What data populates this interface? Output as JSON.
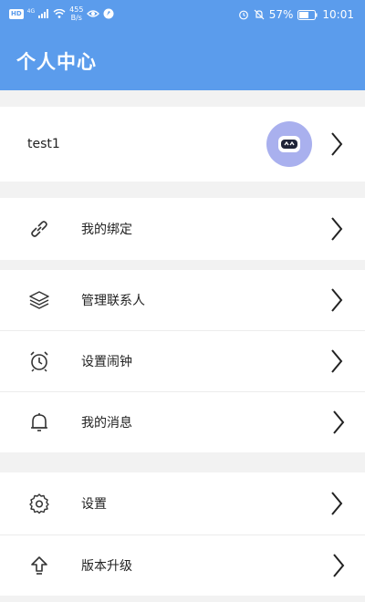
{
  "status_bar": {
    "left_badge": "HD",
    "network": "4G",
    "net_speed_value": "455",
    "net_speed_unit": "B/s",
    "battery": "57%",
    "time": "10:01"
  },
  "header": {
    "title": "个人中心"
  },
  "profile": {
    "username": "test1"
  },
  "menu": {
    "binding": {
      "label": "我的绑定",
      "icon": "link-icon"
    },
    "contacts": {
      "label": "管理联系人",
      "icon": "layers-icon"
    },
    "alarm": {
      "label": "设置闹钟",
      "icon": "alarm-clock-icon"
    },
    "messages": {
      "label": "我的消息",
      "icon": "bell-icon"
    },
    "settings": {
      "label": "设置",
      "icon": "gear-icon"
    },
    "upgrade": {
      "label": "版本升级",
      "icon": "upload-arrow-icon"
    }
  },
  "colors": {
    "header": "#5b9cec",
    "avatar_bg": "#a9b0ee",
    "background": "#f2f2f2"
  }
}
